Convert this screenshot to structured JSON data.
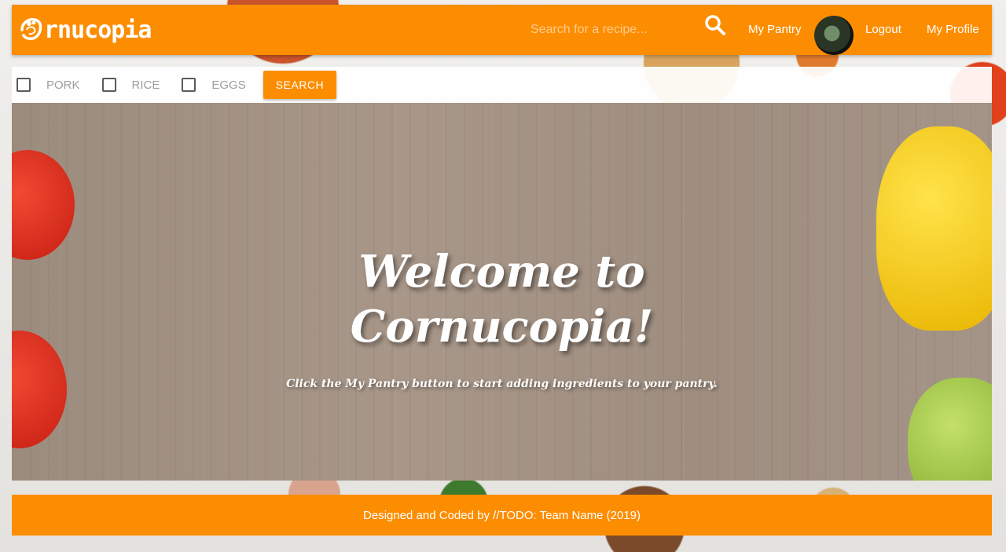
{
  "navbar": {
    "brand_text": "rnucopia",
    "search_placeholder": "Search for a recipe...",
    "links": {
      "pantry": "My Pantry",
      "logout": "Logout",
      "profile": "My Profile"
    },
    "accent_color": "#fd8d00"
  },
  "filters": {
    "items": [
      {
        "label": "PORK",
        "checked": false
      },
      {
        "label": "RICE",
        "checked": false
      },
      {
        "label": "EGGS",
        "checked": false
      }
    ],
    "search_button": "SEARCH"
  },
  "hero": {
    "title": "Welcome to Cornucopia!",
    "subtitle": "Click the My Pantry button to start adding ingredients to your pantry."
  },
  "footer": {
    "text": "Designed and Coded by //TODO: Team Name (2019)"
  }
}
